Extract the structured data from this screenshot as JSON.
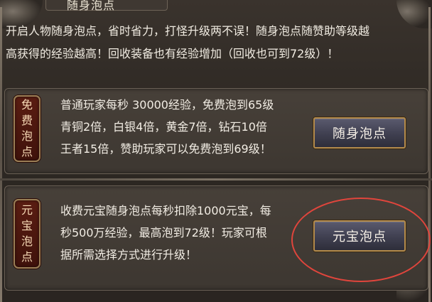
{
  "window": {
    "title": "随身泡点"
  },
  "intro": {
    "line1": "开启人物随身泡点，省时省力，打怪升级两不误！随身泡点随赞助等级越",
    "line2": "高获得的经验越高！回收装备也有经验增加（回收也可到72级）！"
  },
  "free_section": {
    "badge_chars": [
      "免",
      "费",
      "泡",
      "点"
    ],
    "lines": [
      "普通玩家每秒 30000经验，免费泡到65级",
      "青铜2倍，白银4倍，黄金7倍，钻石10倍",
      "王者15倍，赞助玩家可以免费泡到69级！"
    ],
    "button_label": "随身泡点"
  },
  "paid_section": {
    "badge_chars": [
      "元",
      "宝",
      "泡",
      "点"
    ],
    "lines": [
      "收费元宝随身泡点每秒扣除1000元宝，每",
      "秒500万经验，最高泡到72级！玩家可根",
      "据所需选择方式进行升级！"
    ],
    "button_label": "元宝泡点"
  },
  "colors": {
    "highlight_circle": "#e0453c",
    "badge_bg": "#5a1d12",
    "button_border": "#b28a4c"
  },
  "icons": [
    "dragon-ornament-icon"
  ]
}
